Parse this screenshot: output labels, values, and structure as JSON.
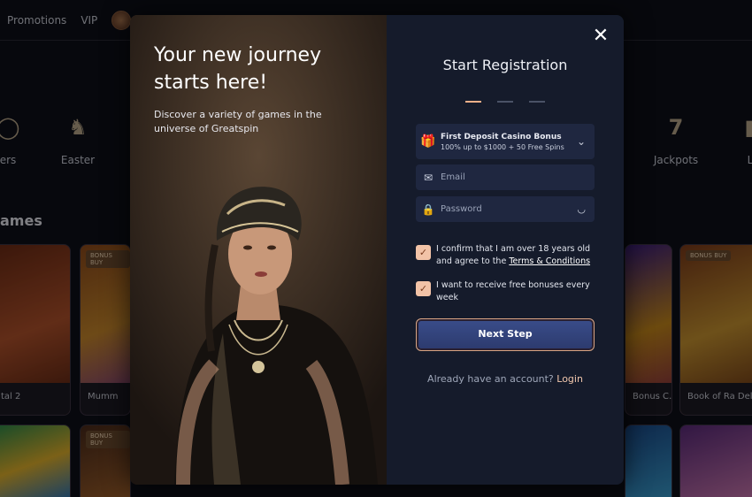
{
  "background": {
    "nav": {
      "promotions": "Promotions",
      "vip": "VIP"
    },
    "categories": [
      {
        "label": "ers",
        "icon": "circle-icon"
      },
      {
        "label": "Easter",
        "icon": "rabbit-icon"
      },
      {
        "label": "Jackpots",
        "icon": "seven-icon"
      },
      {
        "label": "L",
        "icon": "l-icon"
      }
    ],
    "games_title": "ames",
    "tiles": [
      {
        "caption": "tal 2",
        "badge": ""
      },
      {
        "caption": "Mumm",
        "badge": "BONUS BUY"
      },
      {
        "caption": "Bonus C…",
        "badge": ""
      },
      {
        "caption": "Book of Ra Delu",
        "badge": "BONUS BUY"
      },
      {
        "caption": "",
        "badge": ""
      },
      {
        "caption": "",
        "badge": "BONUS BUY"
      }
    ]
  },
  "modal": {
    "left": {
      "headline": "Your new journey starts here!",
      "subtext": "Discover a variety of games in the universe of Greatspin"
    },
    "right": {
      "title": "Start Registration",
      "steps_total": 3,
      "steps_active": 1,
      "bonus": {
        "title": "First Deposit Casino Bonus",
        "subtitle": "100% up to $1000 + 50 Free Spins"
      },
      "email_placeholder": "Email",
      "password_placeholder": "Password",
      "age_confirm_prefix": "I confirm that I am over 18 years old and agree to the ",
      "terms_link": "Terms & Conditions",
      "bonus_optin": "I want to receive free bonuses every week",
      "next_button": "Next Step",
      "login_prompt": "Already have an account?",
      "login_link": "Login"
    },
    "close_icon": "close-icon"
  },
  "colors": {
    "accent": "#f0b089",
    "panel": "#151b2b",
    "field": "#1f2740",
    "button": "#33457c"
  }
}
